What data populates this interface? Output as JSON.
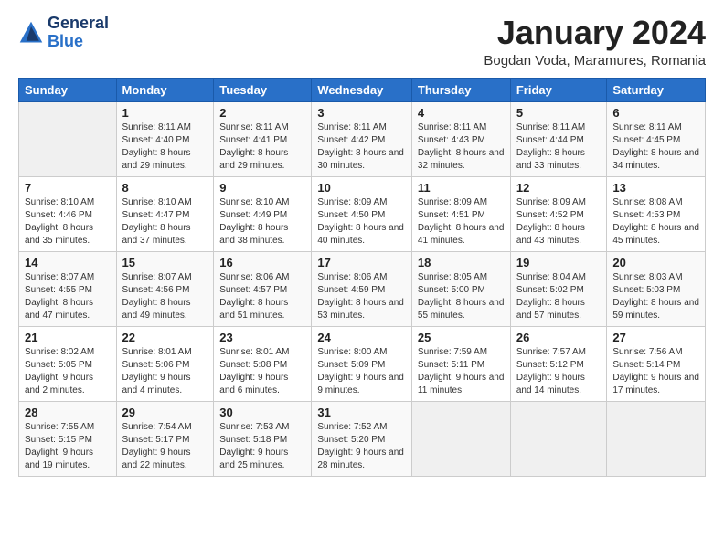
{
  "header": {
    "logo_line1": "General",
    "logo_line2": "Blue",
    "title": "January 2024",
    "location": "Bogdan Voda, Maramures, Romania"
  },
  "weekdays": [
    "Sunday",
    "Monday",
    "Tuesday",
    "Wednesday",
    "Thursday",
    "Friday",
    "Saturday"
  ],
  "weeks": [
    [
      {
        "day": "",
        "sunrise": "",
        "sunset": "",
        "daylight": ""
      },
      {
        "day": "1",
        "sunrise": "Sunrise: 8:11 AM",
        "sunset": "Sunset: 4:40 PM",
        "daylight": "Daylight: 8 hours and 29 minutes."
      },
      {
        "day": "2",
        "sunrise": "Sunrise: 8:11 AM",
        "sunset": "Sunset: 4:41 PM",
        "daylight": "Daylight: 8 hours and 29 minutes."
      },
      {
        "day": "3",
        "sunrise": "Sunrise: 8:11 AM",
        "sunset": "Sunset: 4:42 PM",
        "daylight": "Daylight: 8 hours and 30 minutes."
      },
      {
        "day": "4",
        "sunrise": "Sunrise: 8:11 AM",
        "sunset": "Sunset: 4:43 PM",
        "daylight": "Daylight: 8 hours and 32 minutes."
      },
      {
        "day": "5",
        "sunrise": "Sunrise: 8:11 AM",
        "sunset": "Sunset: 4:44 PM",
        "daylight": "Daylight: 8 hours and 33 minutes."
      },
      {
        "day": "6",
        "sunrise": "Sunrise: 8:11 AM",
        "sunset": "Sunset: 4:45 PM",
        "daylight": "Daylight: 8 hours and 34 minutes."
      }
    ],
    [
      {
        "day": "7",
        "sunrise": "Sunrise: 8:10 AM",
        "sunset": "Sunset: 4:46 PM",
        "daylight": "Daylight: 8 hours and 35 minutes."
      },
      {
        "day": "8",
        "sunrise": "Sunrise: 8:10 AM",
        "sunset": "Sunset: 4:47 PM",
        "daylight": "Daylight: 8 hours and 37 minutes."
      },
      {
        "day": "9",
        "sunrise": "Sunrise: 8:10 AM",
        "sunset": "Sunset: 4:49 PM",
        "daylight": "Daylight: 8 hours and 38 minutes."
      },
      {
        "day": "10",
        "sunrise": "Sunrise: 8:09 AM",
        "sunset": "Sunset: 4:50 PM",
        "daylight": "Daylight: 8 hours and 40 minutes."
      },
      {
        "day": "11",
        "sunrise": "Sunrise: 8:09 AM",
        "sunset": "Sunset: 4:51 PM",
        "daylight": "Daylight: 8 hours and 41 minutes."
      },
      {
        "day": "12",
        "sunrise": "Sunrise: 8:09 AM",
        "sunset": "Sunset: 4:52 PM",
        "daylight": "Daylight: 8 hours and 43 minutes."
      },
      {
        "day": "13",
        "sunrise": "Sunrise: 8:08 AM",
        "sunset": "Sunset: 4:53 PM",
        "daylight": "Daylight: 8 hours and 45 minutes."
      }
    ],
    [
      {
        "day": "14",
        "sunrise": "Sunrise: 8:07 AM",
        "sunset": "Sunset: 4:55 PM",
        "daylight": "Daylight: 8 hours and 47 minutes."
      },
      {
        "day": "15",
        "sunrise": "Sunrise: 8:07 AM",
        "sunset": "Sunset: 4:56 PM",
        "daylight": "Daylight: 8 hours and 49 minutes."
      },
      {
        "day": "16",
        "sunrise": "Sunrise: 8:06 AM",
        "sunset": "Sunset: 4:57 PM",
        "daylight": "Daylight: 8 hours and 51 minutes."
      },
      {
        "day": "17",
        "sunrise": "Sunrise: 8:06 AM",
        "sunset": "Sunset: 4:59 PM",
        "daylight": "Daylight: 8 hours and 53 minutes."
      },
      {
        "day": "18",
        "sunrise": "Sunrise: 8:05 AM",
        "sunset": "Sunset: 5:00 PM",
        "daylight": "Daylight: 8 hours and 55 minutes."
      },
      {
        "day": "19",
        "sunrise": "Sunrise: 8:04 AM",
        "sunset": "Sunset: 5:02 PM",
        "daylight": "Daylight: 8 hours and 57 minutes."
      },
      {
        "day": "20",
        "sunrise": "Sunrise: 8:03 AM",
        "sunset": "Sunset: 5:03 PM",
        "daylight": "Daylight: 8 hours and 59 minutes."
      }
    ],
    [
      {
        "day": "21",
        "sunrise": "Sunrise: 8:02 AM",
        "sunset": "Sunset: 5:05 PM",
        "daylight": "Daylight: 9 hours and 2 minutes."
      },
      {
        "day": "22",
        "sunrise": "Sunrise: 8:01 AM",
        "sunset": "Sunset: 5:06 PM",
        "daylight": "Daylight: 9 hours and 4 minutes."
      },
      {
        "day": "23",
        "sunrise": "Sunrise: 8:01 AM",
        "sunset": "Sunset: 5:08 PM",
        "daylight": "Daylight: 9 hours and 6 minutes."
      },
      {
        "day": "24",
        "sunrise": "Sunrise: 8:00 AM",
        "sunset": "Sunset: 5:09 PM",
        "daylight": "Daylight: 9 hours and 9 minutes."
      },
      {
        "day": "25",
        "sunrise": "Sunrise: 7:59 AM",
        "sunset": "Sunset: 5:11 PM",
        "daylight": "Daylight: 9 hours and 11 minutes."
      },
      {
        "day": "26",
        "sunrise": "Sunrise: 7:57 AM",
        "sunset": "Sunset: 5:12 PM",
        "daylight": "Daylight: 9 hours and 14 minutes."
      },
      {
        "day": "27",
        "sunrise": "Sunrise: 7:56 AM",
        "sunset": "Sunset: 5:14 PM",
        "daylight": "Daylight: 9 hours and 17 minutes."
      }
    ],
    [
      {
        "day": "28",
        "sunrise": "Sunrise: 7:55 AM",
        "sunset": "Sunset: 5:15 PM",
        "daylight": "Daylight: 9 hours and 19 minutes."
      },
      {
        "day": "29",
        "sunrise": "Sunrise: 7:54 AM",
        "sunset": "Sunset: 5:17 PM",
        "daylight": "Daylight: 9 hours and 22 minutes."
      },
      {
        "day": "30",
        "sunrise": "Sunrise: 7:53 AM",
        "sunset": "Sunset: 5:18 PM",
        "daylight": "Daylight: 9 hours and 25 minutes."
      },
      {
        "day": "31",
        "sunrise": "Sunrise: 7:52 AM",
        "sunset": "Sunset: 5:20 PM",
        "daylight": "Daylight: 9 hours and 28 minutes."
      },
      {
        "day": "",
        "sunrise": "",
        "sunset": "",
        "daylight": ""
      },
      {
        "day": "",
        "sunrise": "",
        "sunset": "",
        "daylight": ""
      },
      {
        "day": "",
        "sunrise": "",
        "sunset": "",
        "daylight": ""
      }
    ]
  ]
}
